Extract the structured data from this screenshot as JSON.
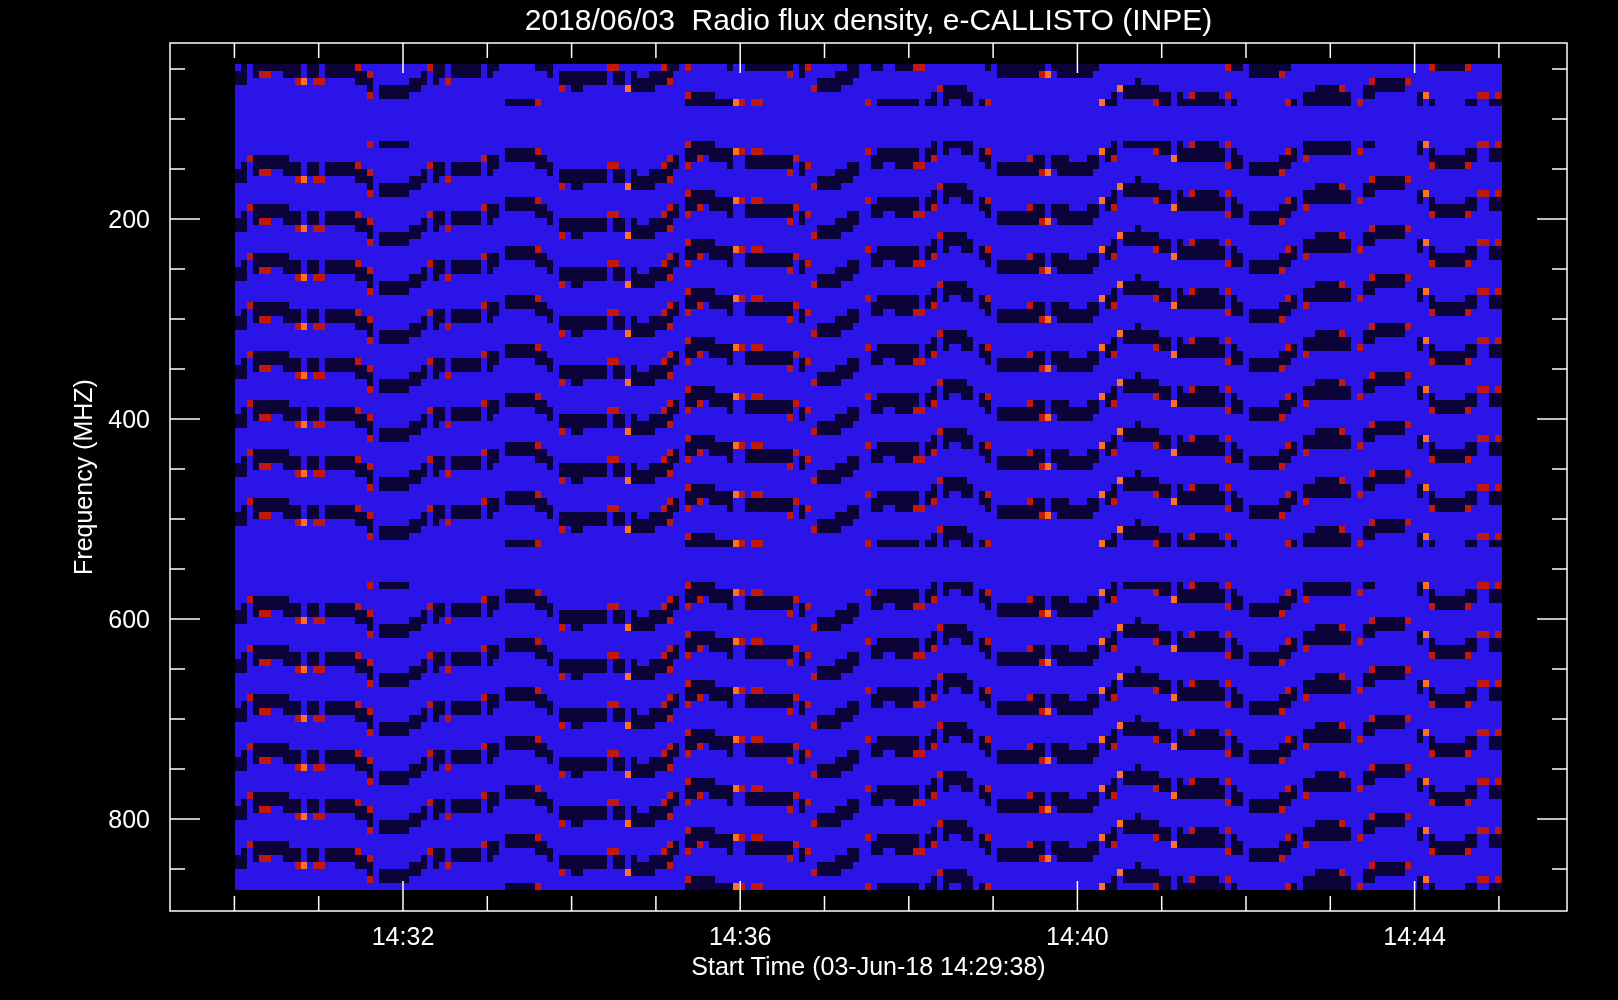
{
  "title": "2018/06/03  Radio flux density, e-CALLISTO (INPE)",
  "y_axis": {
    "label": "Frequency (MHZ)",
    "ticks": [
      "200",
      "400",
      "600",
      "800"
    ]
  },
  "x_axis": {
    "label": "Start Time (03-Jun-18 14:29:38)",
    "ticks": [
      "14:32",
      "14:36",
      "14:40",
      "14:44"
    ]
  }
}
